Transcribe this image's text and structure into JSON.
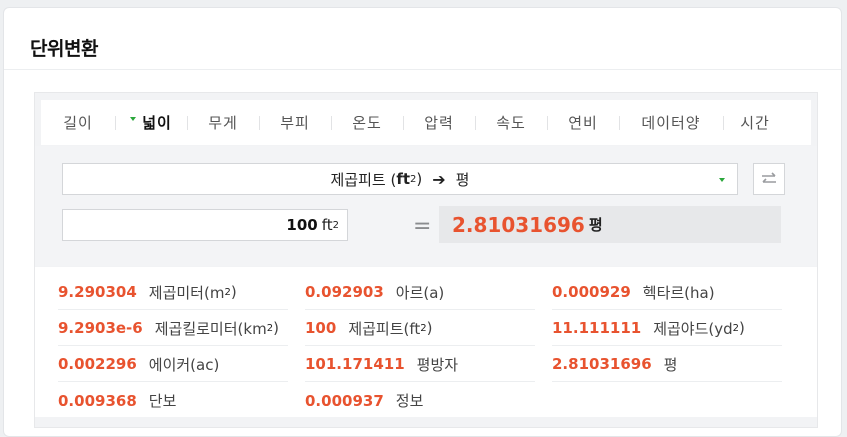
{
  "card": {
    "title": "단위변환"
  },
  "tabs": [
    {
      "label": "길이",
      "active": false
    },
    {
      "label": "넓이",
      "active": true
    },
    {
      "label": "무게",
      "active": false
    },
    {
      "label": "부피",
      "active": false
    },
    {
      "label": "온도",
      "active": false
    },
    {
      "label": "압력",
      "active": false
    },
    {
      "label": "속도",
      "active": false
    },
    {
      "label": "연비",
      "active": false
    },
    {
      "label": "데이터양",
      "active": false
    },
    {
      "label": "시간",
      "active": false
    }
  ],
  "converter": {
    "from_label": "제곱피트 (",
    "from_unit": "ft",
    "from_exp": "2",
    "from_close": ")",
    "arrow": "➔",
    "to_label": "평",
    "input_value": "100",
    "input_unit": "ft",
    "input_exp": "2",
    "equals": "=",
    "result_value": "2.81031696",
    "result_unit": "평"
  },
  "results": [
    {
      "value": "9.290304",
      "unit": "제곱미터(m",
      "exp": "2",
      "close": ")"
    },
    {
      "value": "0.092903",
      "unit": "아르(a)",
      "exp": "",
      "close": ""
    },
    {
      "value": "0.000929",
      "unit": "헥타르(ha)",
      "exp": "",
      "close": ""
    },
    {
      "value": "9.2903e-6",
      "unit": "제곱킬로미터(km",
      "exp": "2",
      "close": ")"
    },
    {
      "value": "100",
      "unit": "제곱피트(ft",
      "exp": "2",
      "close": ")"
    },
    {
      "value": "11.111111",
      "unit": "제곱야드(yd",
      "exp": "2",
      "close": ")"
    },
    {
      "value": "0.002296",
      "unit": "에이커(ac)",
      "exp": "",
      "close": ""
    },
    {
      "value": "101.171411",
      "unit": "평방자",
      "exp": "",
      "close": ""
    },
    {
      "value": "2.81031696",
      "unit": "평",
      "exp": "",
      "close": ""
    },
    {
      "value": "0.009368",
      "unit": "단보",
      "exp": "",
      "close": ""
    },
    {
      "value": "0.000937",
      "unit": "정보",
      "exp": "",
      "close": ""
    }
  ],
  "colors": {
    "accent": "#e8532f",
    "tab_caret": "#2aa73b"
  },
  "icons": {
    "swap": "swap-arrows-icon",
    "active_tab_marker": "caret-down-icon",
    "dropdown": "chevron-down-icon"
  }
}
